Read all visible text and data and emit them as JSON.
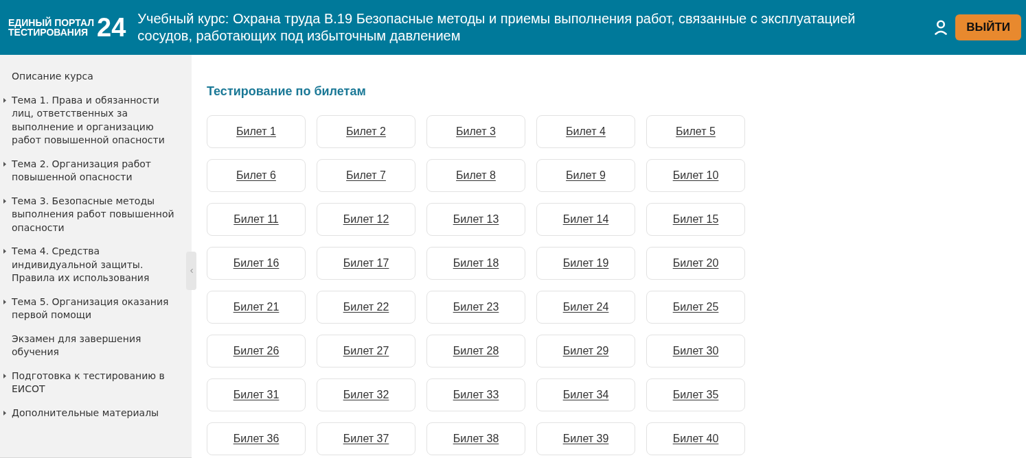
{
  "header": {
    "logo": {
      "line_1": "ЕДИНЫЙ ПОРТАЛ",
      "line_2": "ТЕСТИРОВАНИЯ",
      "number": "24"
    },
    "title": "Учебный курс: Охрана труда В.19 Безопасные методы и приемы выполнения работ, связанные с эксплуатацией сосудов, работающих под избыточным давлением",
    "logout_button": "ВЫЙТИ"
  },
  "sidebar": {
    "items": [
      {
        "label": "Описание курса",
        "expandable": false
      },
      {
        "label": "Тема 1. Права и обязанности лиц, ответственных за выполнение и организацию работ повышенной опасности",
        "expandable": true
      },
      {
        "label": "Тема 2. Организация работ повышенной опасности",
        "expandable": true
      },
      {
        "label": "Тема 3. Безопасные методы выполнения работ повышенной опасности",
        "expandable": true
      },
      {
        "label": "Тема 4. Средства индивидуальной защиты. Правила их использования",
        "expandable": true
      },
      {
        "label": "Тема 5. Организация оказания первой помощи",
        "expandable": true
      },
      {
        "label": "Экзамен для завершения обучения",
        "expandable": false
      },
      {
        "label": "Подготовка к тестированию в ЕИСОТ",
        "expandable": true
      },
      {
        "label": "Дополнительные материалы",
        "expandable": true
      }
    ]
  },
  "main": {
    "heading": "Тестирование по билетам",
    "tickets": [
      "Билет 1",
      "Билет 2",
      "Билет 3",
      "Билет 4",
      "Билет 5",
      "Билет 6",
      "Билет 7",
      "Билет 8",
      "Билет 9",
      "Билет 10",
      "Билет 11",
      "Билет 12",
      "Билет 13",
      "Билет 14",
      "Билет 15",
      "Билет 16",
      "Билет 17",
      "Билет 18",
      "Билет 19",
      "Билет 20",
      "Билет 21",
      "Билет 22",
      "Билет 23",
      "Билет 24",
      "Билет 25",
      "Билет 26",
      "Билет 27",
      "Билет 28",
      "Билет 29",
      "Билет 30",
      "Билет 31",
      "Билет 32",
      "Билет 33",
      "Билет 34",
      "Билет 35",
      "Билет 36",
      "Билет 37",
      "Билет 38",
      "Билет 39",
      "Билет 40"
    ]
  }
}
